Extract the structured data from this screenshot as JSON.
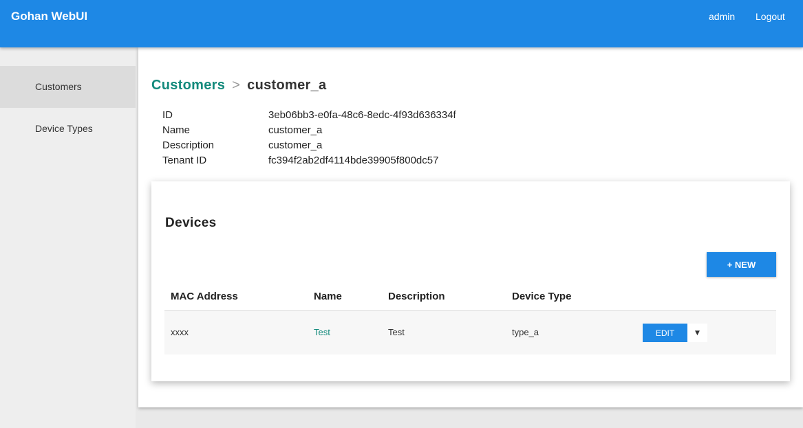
{
  "header": {
    "app_title": "Gohan WebUI",
    "user": "admin",
    "logout": "Logout",
    "accent_color": "#1e88e5"
  },
  "sidebar": {
    "items": [
      {
        "label": "Customers",
        "active": true
      },
      {
        "label": "Device Types",
        "active": false
      }
    ]
  },
  "breadcrumb": {
    "parent": "Customers",
    "separator": ">",
    "current": "customer_a"
  },
  "details": [
    {
      "label": "ID",
      "value": "3eb06bb3-e0fa-48c6-8edc-4f93d636334f"
    },
    {
      "label": "Name",
      "value": "customer_a"
    },
    {
      "label": "Description",
      "value": "customer_a"
    },
    {
      "label": "Tenant ID",
      "value": "fc394f2ab2df4114bde39905f800dc57"
    }
  ],
  "devices": {
    "title": "Devices",
    "new_button": "+ NEW",
    "columns": [
      "MAC Address",
      "Name",
      "Description",
      "Device Type"
    ],
    "rows": [
      {
        "mac": "xxxx",
        "name": "Test",
        "description": "Test",
        "device_type": "type_a",
        "edit_label": "EDIT",
        "dropdown_icon": "caret-down-icon"
      }
    ]
  }
}
